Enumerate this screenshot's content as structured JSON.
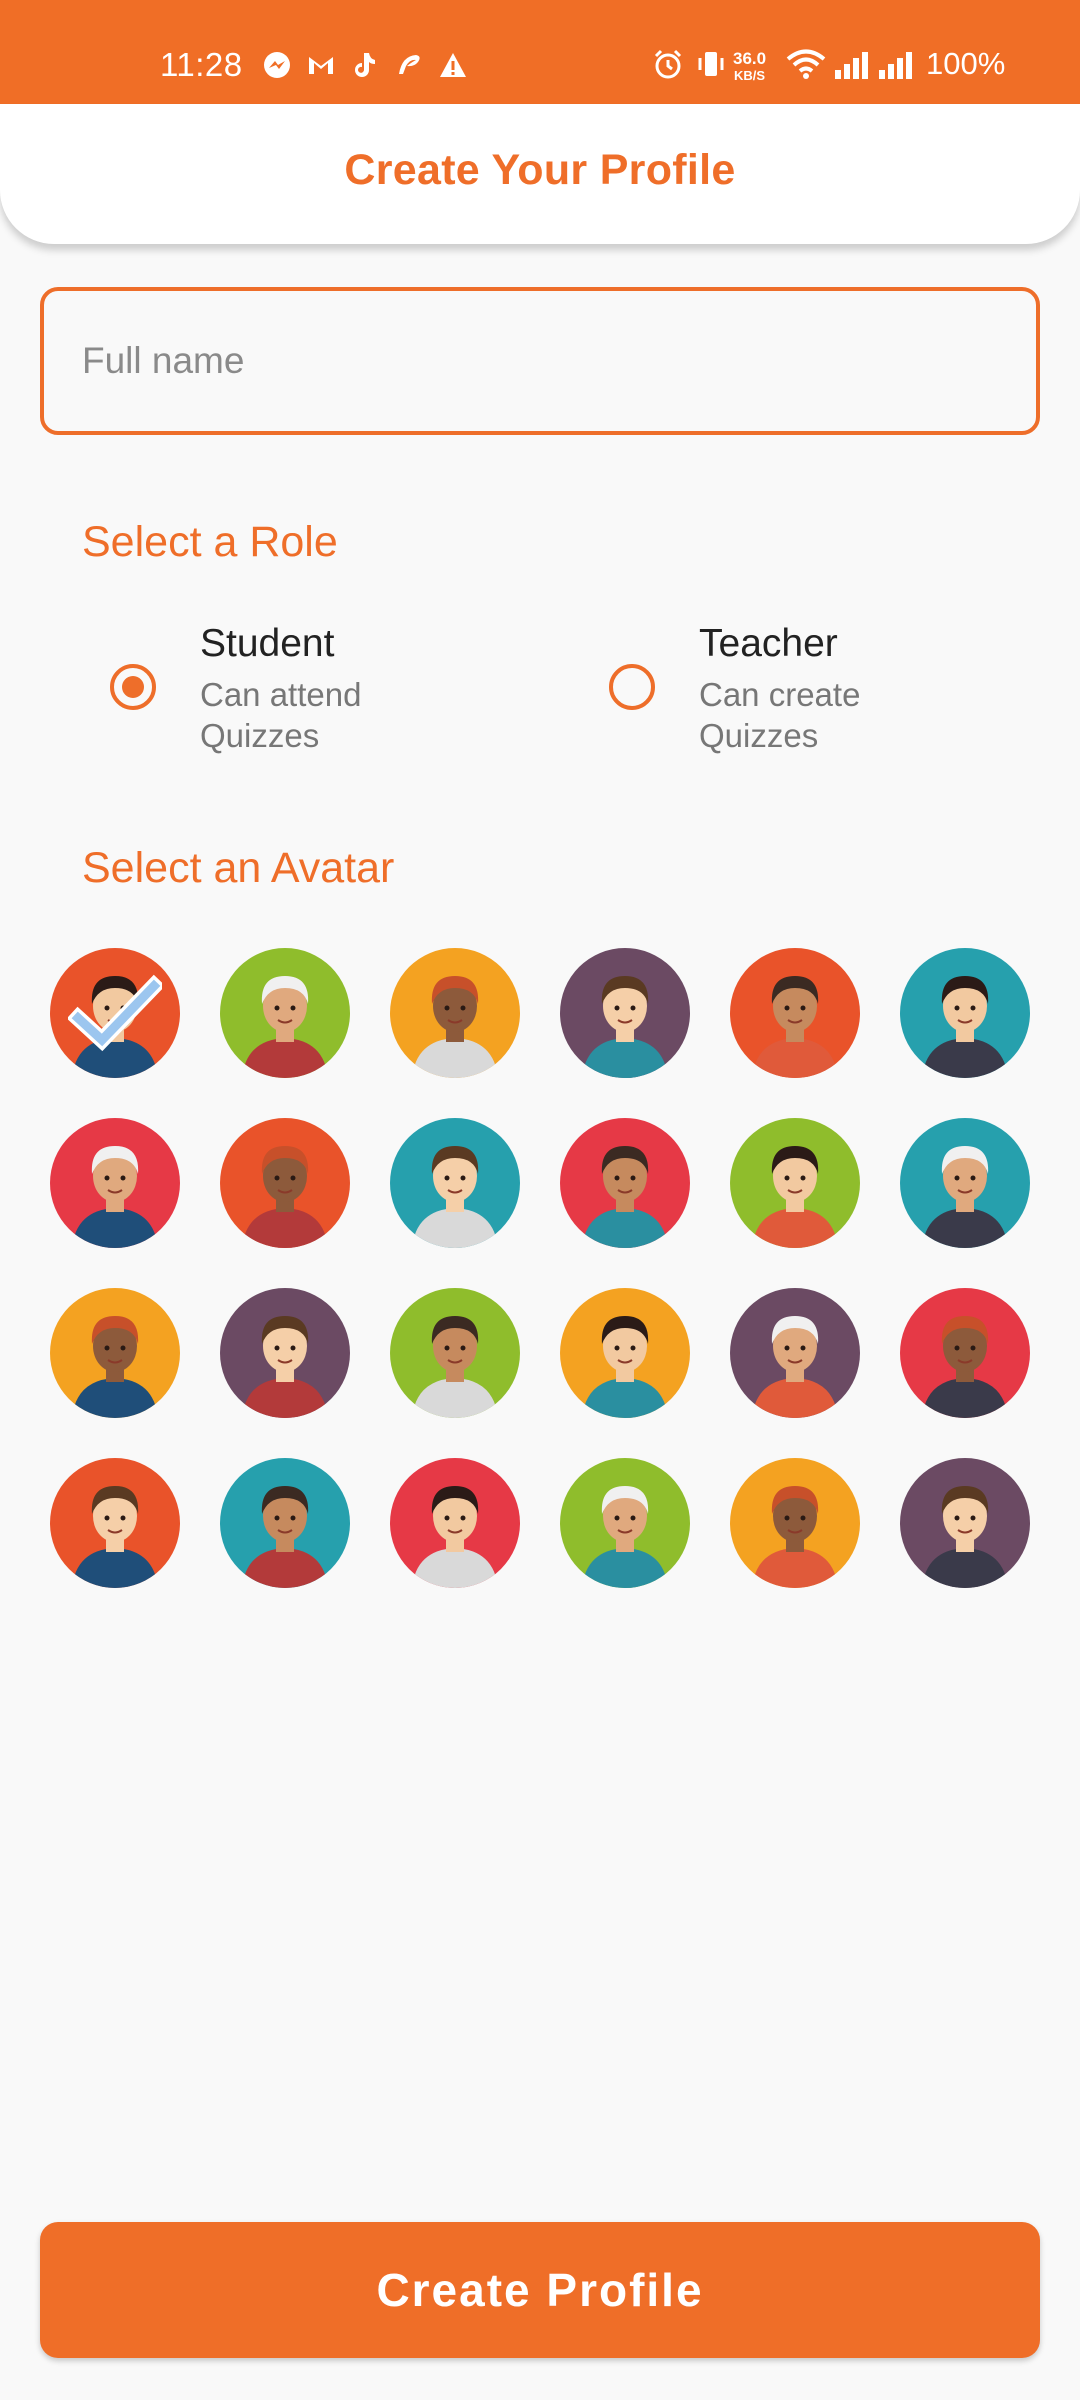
{
  "status_bar": {
    "time": "11:28",
    "network_speed": "36.0",
    "network_speed_unit": "KB/S",
    "battery": "100%",
    "left_icons": [
      "messenger-icon",
      "gmail-icon",
      "tiktok-icon",
      "airtel-icon",
      "warning-icon"
    ],
    "right_icons": [
      "alarm-icon",
      "vibrate-icon",
      "wifi-icon",
      "signal-icon",
      "signal-icon"
    ]
  },
  "header": {
    "title": "Create Your Profile"
  },
  "name_field": {
    "placeholder": "Full name",
    "value": ""
  },
  "role_section": {
    "title": "Select a Role",
    "options": [
      {
        "label": "Student",
        "description": "Can attend Quizzes",
        "selected": true
      },
      {
        "label": "Teacher",
        "description": "Can create Quizzes",
        "selected": false
      }
    ]
  },
  "avatar_section": {
    "title": "Select an Avatar",
    "selected_index": 0,
    "backgrounds": [
      "#e9532a",
      "#8fbd2c",
      "#f4a221",
      "#6b4a63",
      "#e9532a",
      "#26a0ad",
      "#e63946",
      "#e9532a",
      "#26a0ad",
      "#e63946",
      "#8fbd2c",
      "#26a0ad",
      "#f4a221",
      "#6b4a63",
      "#8fbd2c",
      "#f4a221",
      "#6b4a63",
      "#e63946",
      "#e9532a",
      "#26a0ad",
      "#e63946",
      "#8fbd2c",
      "#f4a221",
      "#6b4a63"
    ]
  },
  "submit": {
    "label": "Create Profile"
  },
  "colors": {
    "accent": "#ef6e28",
    "background": "#f9f9f9"
  }
}
